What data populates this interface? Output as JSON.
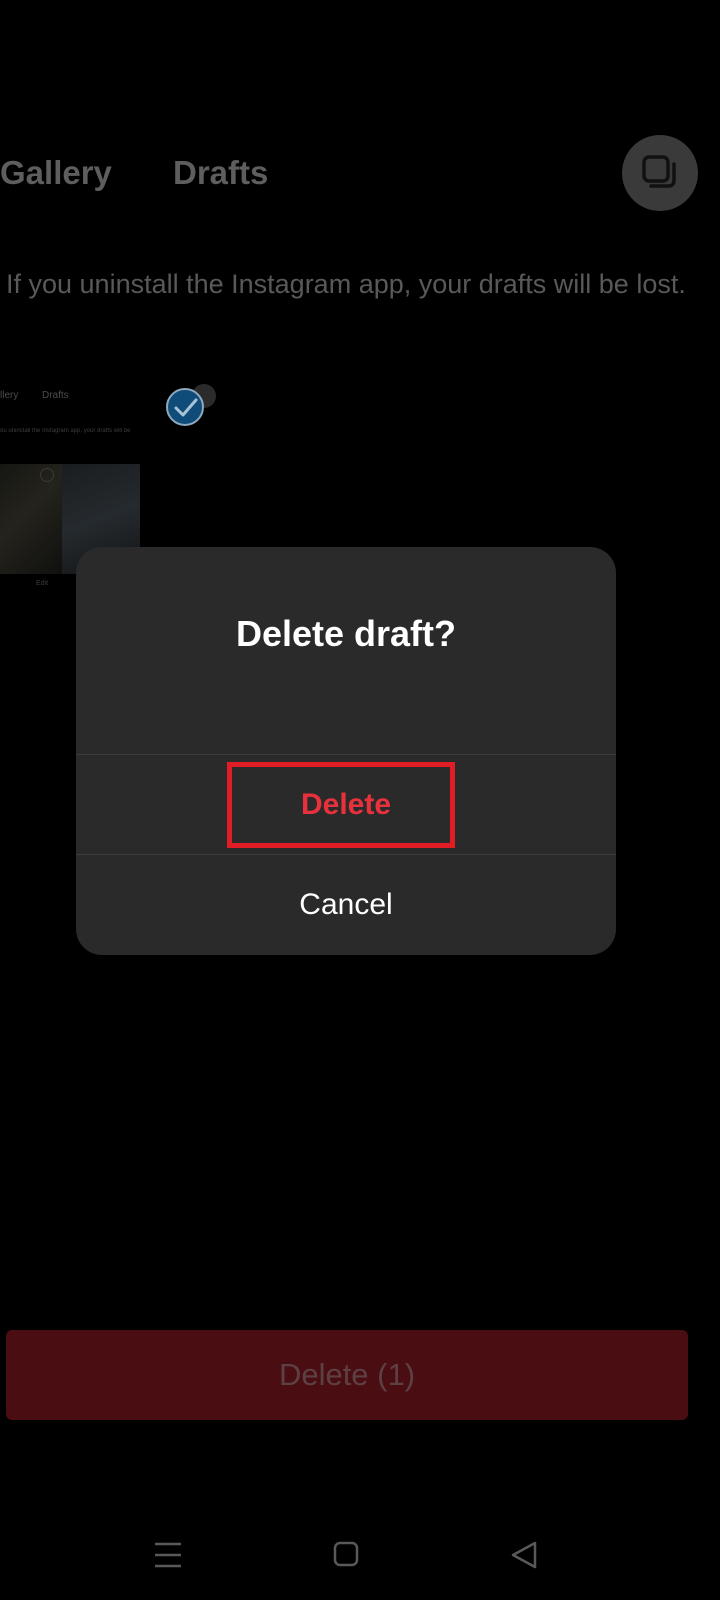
{
  "tabs": {
    "gallery_label": "Gallery",
    "drafts_label": "Drafts"
  },
  "multi_select_icon": "stacked-squares-icon",
  "info_text": "If you uninstall the Instagram app, your drafts will be lost.",
  "thumbnail": {
    "gallery_label": "llery",
    "drafts_label": "Drafts",
    "info_text": "ou uninstall the Instagram app, your drafts will be",
    "caption": "Edit",
    "check_icon": "check-circle-icon"
  },
  "dialog": {
    "title": "Delete draft?",
    "delete_label": "Delete",
    "cancel_label": "Cancel",
    "delete_color": "#e8313c",
    "highlight_color": "#e01c24"
  },
  "bottom_button": {
    "label": "Delete (1)",
    "color": "#4a0d12"
  },
  "navbar": {
    "menu_icon": "menu-icon",
    "home_icon": "home-square-icon",
    "back_icon": "back-triangle-icon"
  }
}
